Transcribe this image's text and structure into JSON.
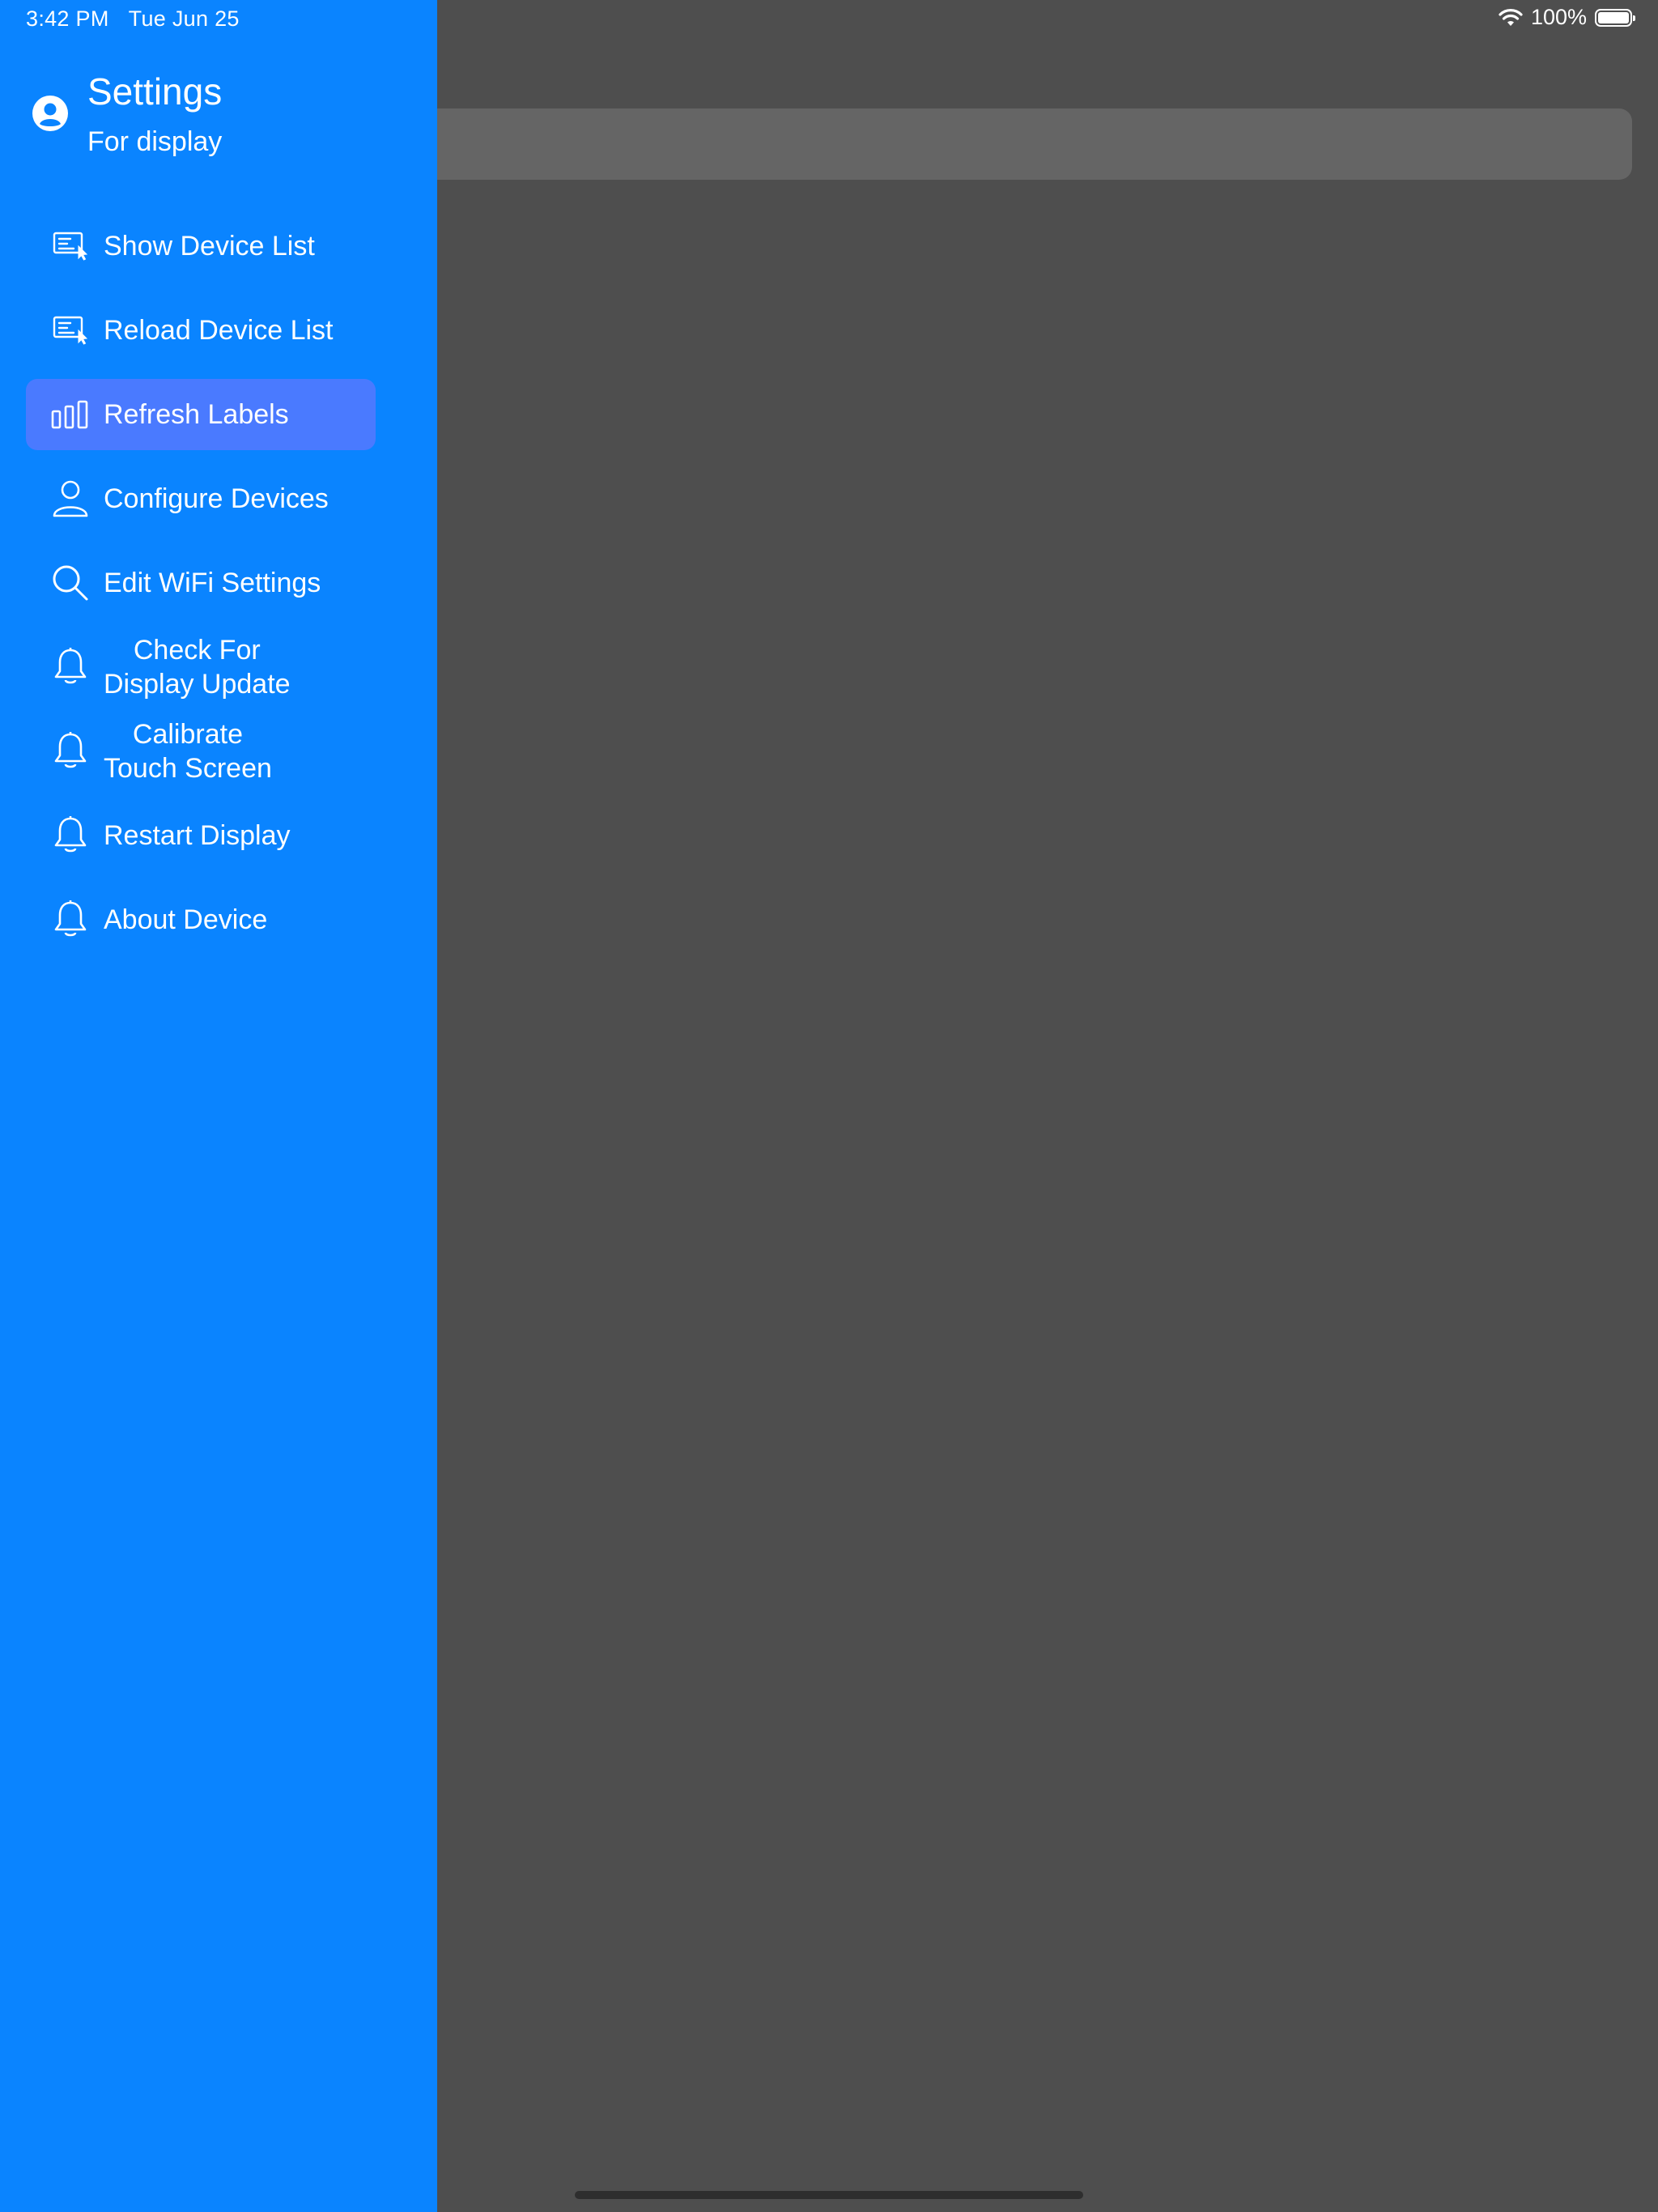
{
  "status_bar": {
    "time": "3:42 PM",
    "date": "Tue Jun 25",
    "battery_percent": "100%"
  },
  "drawer": {
    "title": "Settings",
    "subtitle": "For display",
    "items": [
      {
        "label": "Show Device List",
        "icon": "list-cursor-icon"
      },
      {
        "label": "Reload Device List",
        "icon": "list-cursor-icon"
      },
      {
        "label": "Refresh Labels",
        "icon": "bar-chart-icon",
        "selected": true
      },
      {
        "label": "Configure Devices",
        "icon": "person-icon"
      },
      {
        "label": "Edit WiFi Settings",
        "icon": "search-icon"
      },
      {
        "label_line1": "Check For",
        "label_line2": "Display Update",
        "icon": "bell-icon"
      },
      {
        "label_line1": "Calibrate",
        "label_line2": "Touch Screen",
        "icon": "bell-icon"
      },
      {
        "label": "Restart Display",
        "icon": "bell-icon"
      },
      {
        "label": "About Device",
        "icon": "bell-icon"
      }
    ]
  },
  "colors": {
    "drawer_bg": "#0a84ff",
    "selected_bg": "#4a7aff",
    "overlay_bg": "#4e4e4e"
  }
}
